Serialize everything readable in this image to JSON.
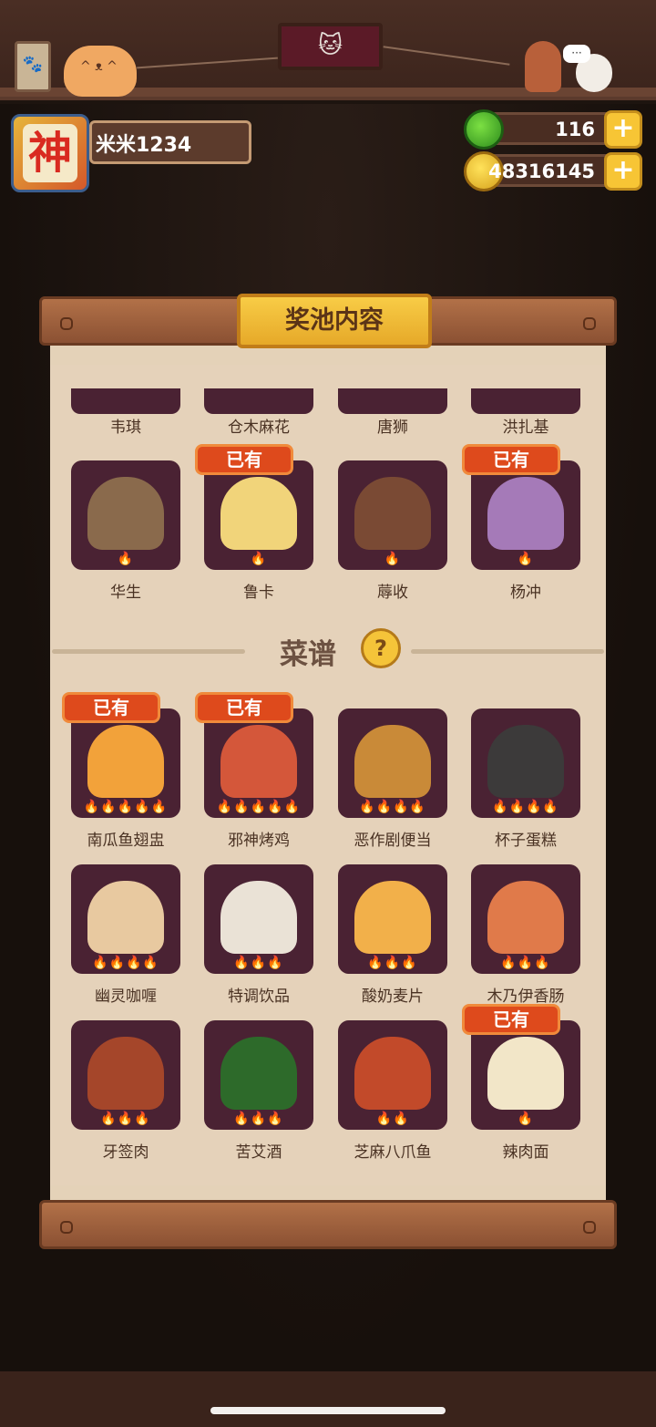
{
  "player": {
    "name": "米米1234",
    "avatar_text": "神"
  },
  "currency": {
    "gems": "116",
    "coins": "48316145",
    "plus": "+"
  },
  "popup": {
    "title": "奖池内容",
    "recipes_title": "菜谱",
    "help": "?"
  },
  "owned_label": "已有",
  "scene": {
    "sign": "🐾",
    "frame": "🐱",
    "bubble": "···"
  },
  "top_row": [
    "韦琪",
    "仓木麻花",
    "唐狮",
    "洪扎基"
  ],
  "characters": [
    {
      "name": "华生",
      "owned": false,
      "flames": "🔥",
      "color": "#8a6a4c"
    },
    {
      "name": "鲁卡",
      "owned": true,
      "flames": "🔥",
      "color": "#f1d47a"
    },
    {
      "name": "蓐收",
      "owned": false,
      "flames": "🔥",
      "color": "#7a4a34"
    },
    {
      "name": "杨冲",
      "owned": true,
      "flames": "🔥",
      "color": "#a57ab8"
    }
  ],
  "recipes": [
    {
      "name": "南瓜鱼翅盅",
      "owned": true,
      "flames": "🔥🔥🔥🔥🔥",
      "color": "#f2a23a"
    },
    {
      "name": "邪神烤鸡",
      "owned": true,
      "flames": "🔥🔥🔥🔥🔥",
      "color": "#d4573a"
    },
    {
      "name": "恶作剧便当",
      "owned": false,
      "flames": "🔥🔥🔥🔥",
      "color": "#c98a38"
    },
    {
      "name": "杯子蛋糕",
      "owned": false,
      "flames": "🔥🔥🔥🔥",
      "color": "#3c3a3a"
    },
    {
      "name": "幽灵咖喱",
      "owned": false,
      "flames": "🔥🔥🔥🔥",
      "color": "#e8c9a0"
    },
    {
      "name": "特调饮品",
      "owned": false,
      "flames": "🔥🔥🔥",
      "color": "#eae2d6"
    },
    {
      "name": "酸奶麦片",
      "owned": false,
      "flames": "🔥🔥🔥",
      "color": "#f2b04a"
    },
    {
      "name": "木乃伊香肠",
      "owned": false,
      "flames": "🔥🔥🔥",
      "color": "#e07a4a"
    },
    {
      "name": "牙签肉",
      "owned": false,
      "flames": "🔥🔥🔥",
      "color": "#a5462a"
    },
    {
      "name": "苦艾酒",
      "owned": false,
      "flames": "🔥🔥🔥",
      "color": "#2d6a2a"
    },
    {
      "name": "芝麻八爪鱼",
      "owned": false,
      "flames": "🔥🔥",
      "color": "#c24a2a"
    },
    {
      "name": "辣肉面",
      "owned": true,
      "flames": "🔥",
      "color": "#f2e6c8"
    }
  ]
}
